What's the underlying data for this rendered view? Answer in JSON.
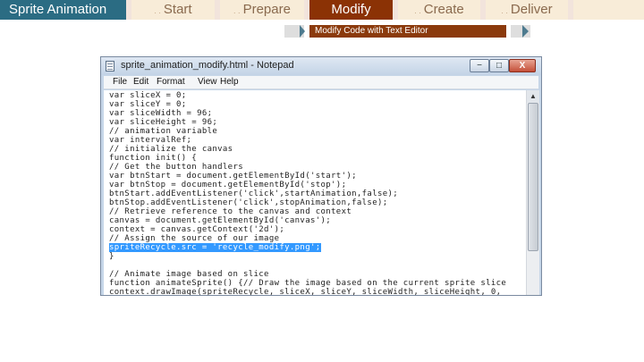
{
  "nav": {
    "title": "Sprite Animation",
    "tabs": [
      {
        "label": "Start",
        "state": "inactive"
      },
      {
        "label": "Prepare",
        "state": "inactive"
      },
      {
        "label": "Modify",
        "state": "active"
      },
      {
        "label": "Create",
        "state": "inactive"
      },
      {
        "label": "Deliver",
        "state": "inactive"
      }
    ],
    "tab_marker": ". .",
    "colors": {
      "title_bg": "#2b6c83",
      "active_bg": "#8b3205",
      "inactive_bg": "#f8ecd8",
      "inactive_text": "#8a6a4e"
    }
  },
  "subbar": {
    "label": "Modify Code with Text Editor",
    "color": "#8b3a0c",
    "arrow_color": "#4d7a8e"
  },
  "window": {
    "title": "sprite_animation_modify.html - Notepad",
    "controls": {
      "minimize": "−",
      "maximize": "□",
      "close": "X"
    },
    "menu": [
      "File",
      "Edit",
      "Format",
      "View",
      "Help"
    ],
    "scroll_up_icon": "▲",
    "selection_color": "#3399ff",
    "code_lines": [
      "var sliceX = 0;",
      "var sliceY = 0;",
      "var sliceWidth = 96;",
      "var sliceHeight = 96;",
      "// animation variable",
      "var intervalRef;",
      "// initialize the canvas",
      "function init() {",
      "// Get the button handlers",
      "var btnStart = document.getElementById('start');",
      "var btnStop = document.getElementById('stop');",
      "btnStart.addEventListener('click',startAnimation,false);",
      "btnStop.addEventListener('click',stopAnimation,false);",
      "// Retrieve reference to the canvas and context",
      "canvas = document.getElementById('canvas');",
      "context = canvas.getContext('2d');",
      "// Assign the source of our image",
      "spriteRecycle.src = 'recycle_modify.png';",
      "}",
      "",
      "// Animate image based on slice",
      "function animateSprite() {// Draw the image based on the current sprite slice",
      "context.drawImage(spriteRecycle, sliceX, sliceY, sliceWidth, sliceHeight, 0,"
    ],
    "selected_line": 17
  }
}
